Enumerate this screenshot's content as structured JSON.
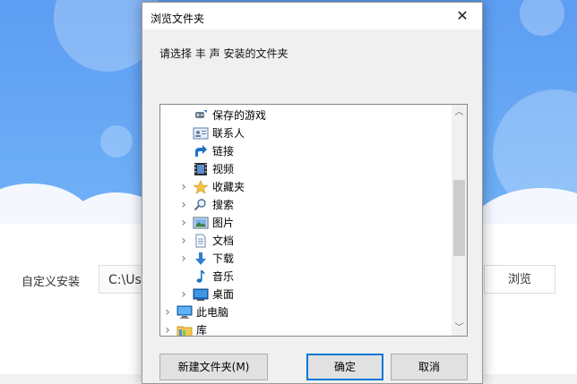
{
  "background": {
    "install_label": "自定义安装",
    "path_value": "C:\\Use",
    "browse_label": "浏览"
  },
  "dialog": {
    "title": "浏览文件夹",
    "close_glyph": "✕",
    "prompt": "请选择 丰 声 安装的文件夹",
    "tree": [
      {
        "label": "保存的游戏",
        "icon": "saved-games-icon",
        "expander": false,
        "indent": 2
      },
      {
        "label": "联系人",
        "icon": "contacts-icon",
        "expander": false,
        "indent": 2
      },
      {
        "label": "链接",
        "icon": "links-icon",
        "expander": false,
        "indent": 2
      },
      {
        "label": "视频",
        "icon": "videos-icon",
        "expander": false,
        "indent": 2
      },
      {
        "label": "收藏夹",
        "icon": "favorites-icon",
        "expander": true,
        "indent": 2
      },
      {
        "label": "搜索",
        "icon": "search-icon",
        "expander": true,
        "indent": 2
      },
      {
        "label": "图片",
        "icon": "pictures-icon",
        "expander": true,
        "indent": 2
      },
      {
        "label": "文档",
        "icon": "documents-icon",
        "expander": true,
        "indent": 2
      },
      {
        "label": "下载",
        "icon": "downloads-icon",
        "expander": true,
        "indent": 2
      },
      {
        "label": "音乐",
        "icon": "music-icon",
        "expander": false,
        "indent": 2
      },
      {
        "label": "桌面",
        "icon": "desktop-icon",
        "expander": true,
        "indent": 2
      },
      {
        "label": "此电脑",
        "icon": "this-pc-icon",
        "expander": true,
        "indent": 1
      },
      {
        "label": "库",
        "icon": "libraries-icon",
        "expander": true,
        "indent": 1
      }
    ],
    "buttons": {
      "new_folder": "新建文件夹(M)",
      "ok": "确定",
      "cancel": "取消"
    },
    "accent_color": "#0078d7"
  }
}
